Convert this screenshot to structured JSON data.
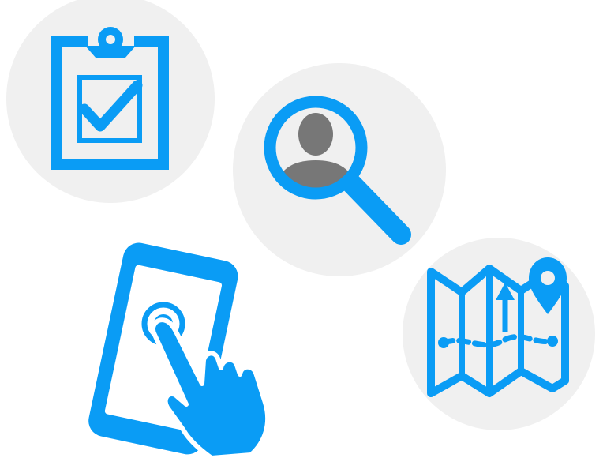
{
  "icons": [
    {
      "name": "clipboard-check-icon"
    },
    {
      "name": "user-search-icon"
    },
    {
      "name": "tablet-tap-icon"
    },
    {
      "name": "map-route-icon"
    }
  ],
  "colors": {
    "accent": "#0a9cf5",
    "circle_bg": "#f0f0f0",
    "person": "#777777"
  }
}
